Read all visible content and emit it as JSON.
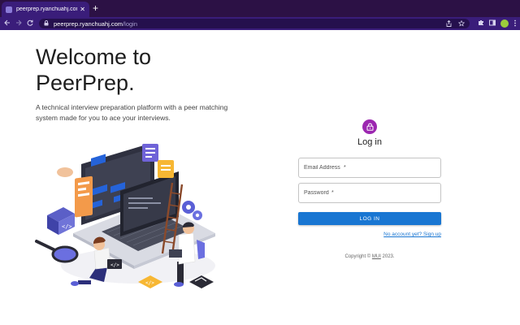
{
  "browser": {
    "tab_title": "peerprep.ryanchuahj.com/login",
    "tab_close": "✕",
    "new_tab": "+",
    "url_host": "peerprep.ryanchuahj.com",
    "url_path": "/login",
    "icons": [
      "back-icon",
      "forward-icon",
      "reload-icon",
      "lock-icon",
      "share-icon",
      "star-icon",
      "extensions-icon",
      "sidebar-icon",
      "profile-avatar",
      "menu-icon"
    ]
  },
  "hero": {
    "title": "Welcome to PeerPrep.",
    "subtitle": "A technical interview preparation platform with a peer matching system made for you to ace your interviews."
  },
  "login": {
    "heading": "Log in",
    "email_placeholder": "Email Address",
    "password_placeholder": "Password",
    "required_mark": "*",
    "submit_label": "LOG IN",
    "signup_link": "No account yet? Sign up",
    "copyright_prefix": "Copyright © ",
    "copyright_brand": "MUI",
    "copyright_suffix": " 2023."
  },
  "colors": {
    "chrome_tabbar": "#2c1145",
    "chrome_toolbar": "#3a1d7a",
    "avatar_purple": "#9c27b0",
    "primary_blue": "#1976d2"
  }
}
